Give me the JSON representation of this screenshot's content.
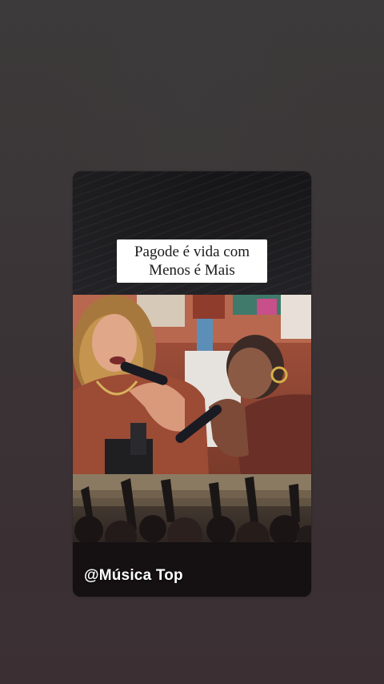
{
  "story": {
    "caption_line1": "Pagode é vida com",
    "caption_line2": "Menos é Mais",
    "handle": "@Música Top"
  },
  "colors": {
    "background": "#3a3436",
    "caption_bg": "#ffffff",
    "caption_text": "#1a1a1a",
    "handle_text": "#ffffff"
  }
}
